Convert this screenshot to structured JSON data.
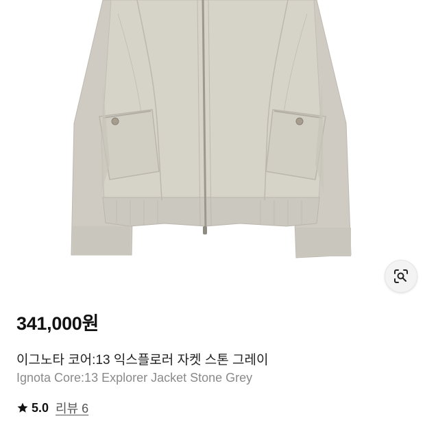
{
  "product": {
    "price": "341,000원",
    "title_ko": "이그노타 코어:13 익스플로러 자켓 스톤 그레이",
    "title_en": "Ignota Core:13 Explorer Jacket Stone Grey",
    "rating": "5.0",
    "review_link": "리뷰 6"
  },
  "icons": {
    "lens": "lens-search-icon",
    "star": "star-icon"
  },
  "colors": {
    "jacket": "#d4d1c7",
    "price": "#111111",
    "subtitle": "#8a8a8a"
  }
}
